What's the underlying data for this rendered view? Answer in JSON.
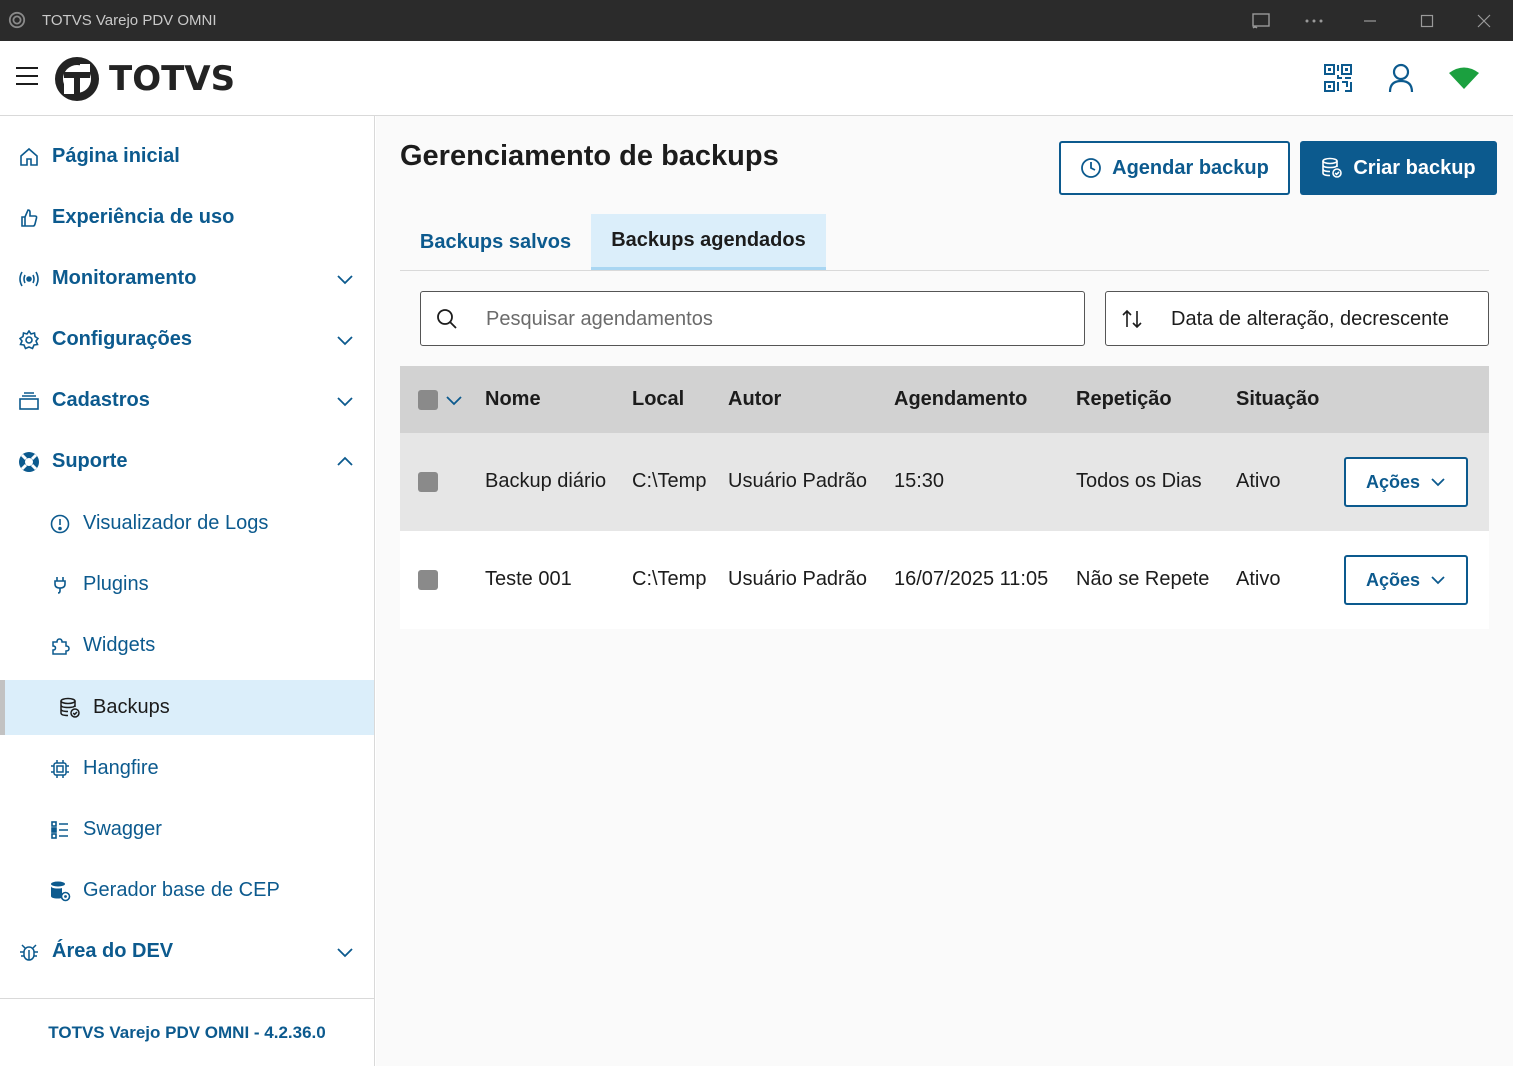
{
  "window": {
    "title": "TOTVS Varejo PDV OMNI"
  },
  "header": {
    "logo_text": "TOTVS",
    "status_color": "#1ba03f"
  },
  "sidebar": {
    "items": [
      {
        "label": "Página inicial",
        "icon": "home-icon"
      },
      {
        "label": "Experiência de uso",
        "icon": "thumbs-up-icon"
      },
      {
        "label": "Monitoramento",
        "icon": "broadcast-icon"
      },
      {
        "label": "Configurações",
        "icon": "gear-icon"
      },
      {
        "label": "Cadastros",
        "icon": "stack-icon"
      },
      {
        "label": "Suporte",
        "icon": "lifebuoy-icon"
      }
    ],
    "support_items": [
      {
        "label": "Visualizador de Logs",
        "icon": "alert-circle-icon"
      },
      {
        "label": "Plugins",
        "icon": "plug-icon"
      },
      {
        "label": "Widgets",
        "icon": "puzzle-icon"
      },
      {
        "label": "Backups",
        "icon": "database-icon"
      },
      {
        "label": "Hangfire",
        "icon": "chip-icon"
      },
      {
        "label": "Swagger",
        "icon": "list-check-icon"
      },
      {
        "label": "Gerador base de CEP",
        "icon": "database-gear-icon"
      }
    ],
    "dev_item": {
      "label": "Área do DEV",
      "icon": "bug-icon"
    },
    "footer": "TOTVS Varejo PDV OMNI - 4.2.36.0"
  },
  "main": {
    "title": "Gerenciamento de backups",
    "schedule_button": "Agendar backup",
    "create_button": "Criar backup",
    "tabs": [
      {
        "label": "Backups salvos",
        "active": false
      },
      {
        "label": "Backups agendados",
        "active": true
      }
    ],
    "search_placeholder": "Pesquisar agendamentos",
    "sort_label": "Data de alteração, decrescente",
    "table": {
      "headers": [
        "Nome",
        "Local",
        "Autor",
        "Agendamento",
        "Repetição",
        "Situação"
      ],
      "rows": [
        {
          "nome": "Backup diário",
          "local": "C:\\Temp",
          "autor": "Usuário Padrão",
          "agendamento": "15:30",
          "repeticao": "Todos os Dias",
          "situacao": "Ativo",
          "acoes": "Ações"
        },
        {
          "nome": "Teste 001",
          "local": "C:\\Temp",
          "autor": "Usuário Padrão",
          "agendamento": "16/07/2025 11:05",
          "repeticao": "Não se Repete",
          "situacao": "Ativo",
          "acoes": "Ações"
        }
      ]
    }
  },
  "colors": {
    "primary": "#0c5a8e",
    "active_bg": "#dbeefa",
    "titlebar": "#2b2b2b"
  }
}
